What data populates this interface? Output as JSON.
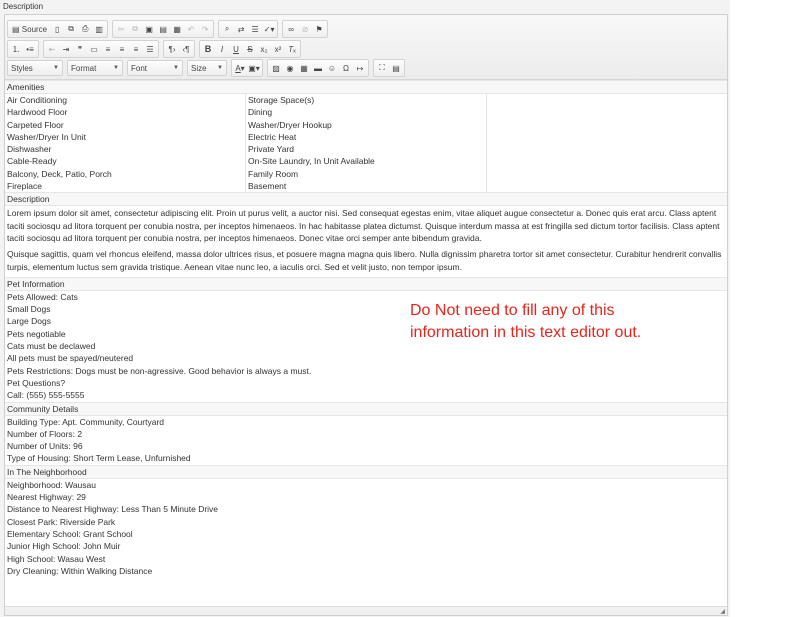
{
  "field_label": "Description",
  "toolbar": {
    "source_label": "Source",
    "styles_label": "Styles",
    "format_label": "Format",
    "font_label": "Font",
    "size_label": "Size"
  },
  "amenities": {
    "header": "Amenities",
    "col1": [
      "Air Conditioning",
      "Hardwood Floor",
      "Carpeted Floor",
      "Washer/Dryer In Unit",
      "Dishwasher",
      "Cable-Ready",
      "Balcony, Deck, Patio, Porch",
      "Fireplace"
    ],
    "col2": [
      "Storage Space(s)",
      "Dining",
      "Washer/Dryer Hookup",
      "Electric Heat",
      "Private Yard",
      "On-Site Laundry, In Unit Available",
      "Family Room",
      "Basement"
    ]
  },
  "description": {
    "header": "Description",
    "p1": "Lorem ipsum dolor sit amet, consectetur adipiscing elit. Proin ut purus velit, a auctor nisi. Sed consequat egestas enim, vitae aliquet augue consectetur a. Donec quis erat arcu. Class aptent taciti sociosqu ad litora torquent per conubia nostra, per inceptos himenaeos. In hac habitasse platea dictumst. Quisque interdum massa at est fringilla sed dictum tortor facilisis. Class aptent taciti sociosqu ad litora torquent per conubia nostra, per inceptos himenaeos. Donec vitae orci semper ante bibendum gravida.",
    "p2": "Quisque sagittis, quam vel rhoncus eleifend, massa dolor ultrices risus, et posuere magna magna quis libero. Nulla dignissim pharetra tortor sit amet consectetur. Curabitur hendrerit convallis turpis, elementum luctus sem gravida tristique. Aenean vitae nunc leo, a iaculis orci. Sed et velit justo, non tempor ipsum."
  },
  "pet": {
    "header": "Pet Information",
    "lines": [
      "Pets Allowed: Cats",
      "Small Dogs",
      "Large Dogs",
      "Pets negotiable",
      "Cats must be declawed",
      "All pets must be spayed/neutered",
      "Pets Restrictions: Dogs must be non-agressive. Good behavior is always a must.",
      "Pet Questions?",
      "Call: (555) 555-5555"
    ]
  },
  "community": {
    "header": "Community Details",
    "lines": [
      "Building Type: Apt. Community, Courtyard",
      "Number of Floors: 2",
      "Number of Units: 96",
      "Type of Housing: Short Term Lease, Unfurnished"
    ]
  },
  "neighborhood": {
    "header": "In The Neighborhood",
    "lines": [
      "Neighborhood: Wausau",
      "Nearest Highway: 29",
      "Distance to Nearest Highway: Less Than 5 Minute Drive",
      "Closest Park: Riverside Park",
      "Elementary School: Grant School",
      "Junior High School: John Muir",
      "High School: Wasau West",
      "Dry Cleaning: Within Walking Distance"
    ]
  },
  "annotation": "Do Not need to fill any of this information in this text editor out.",
  "colors": {
    "annotation": "#e8241b"
  }
}
